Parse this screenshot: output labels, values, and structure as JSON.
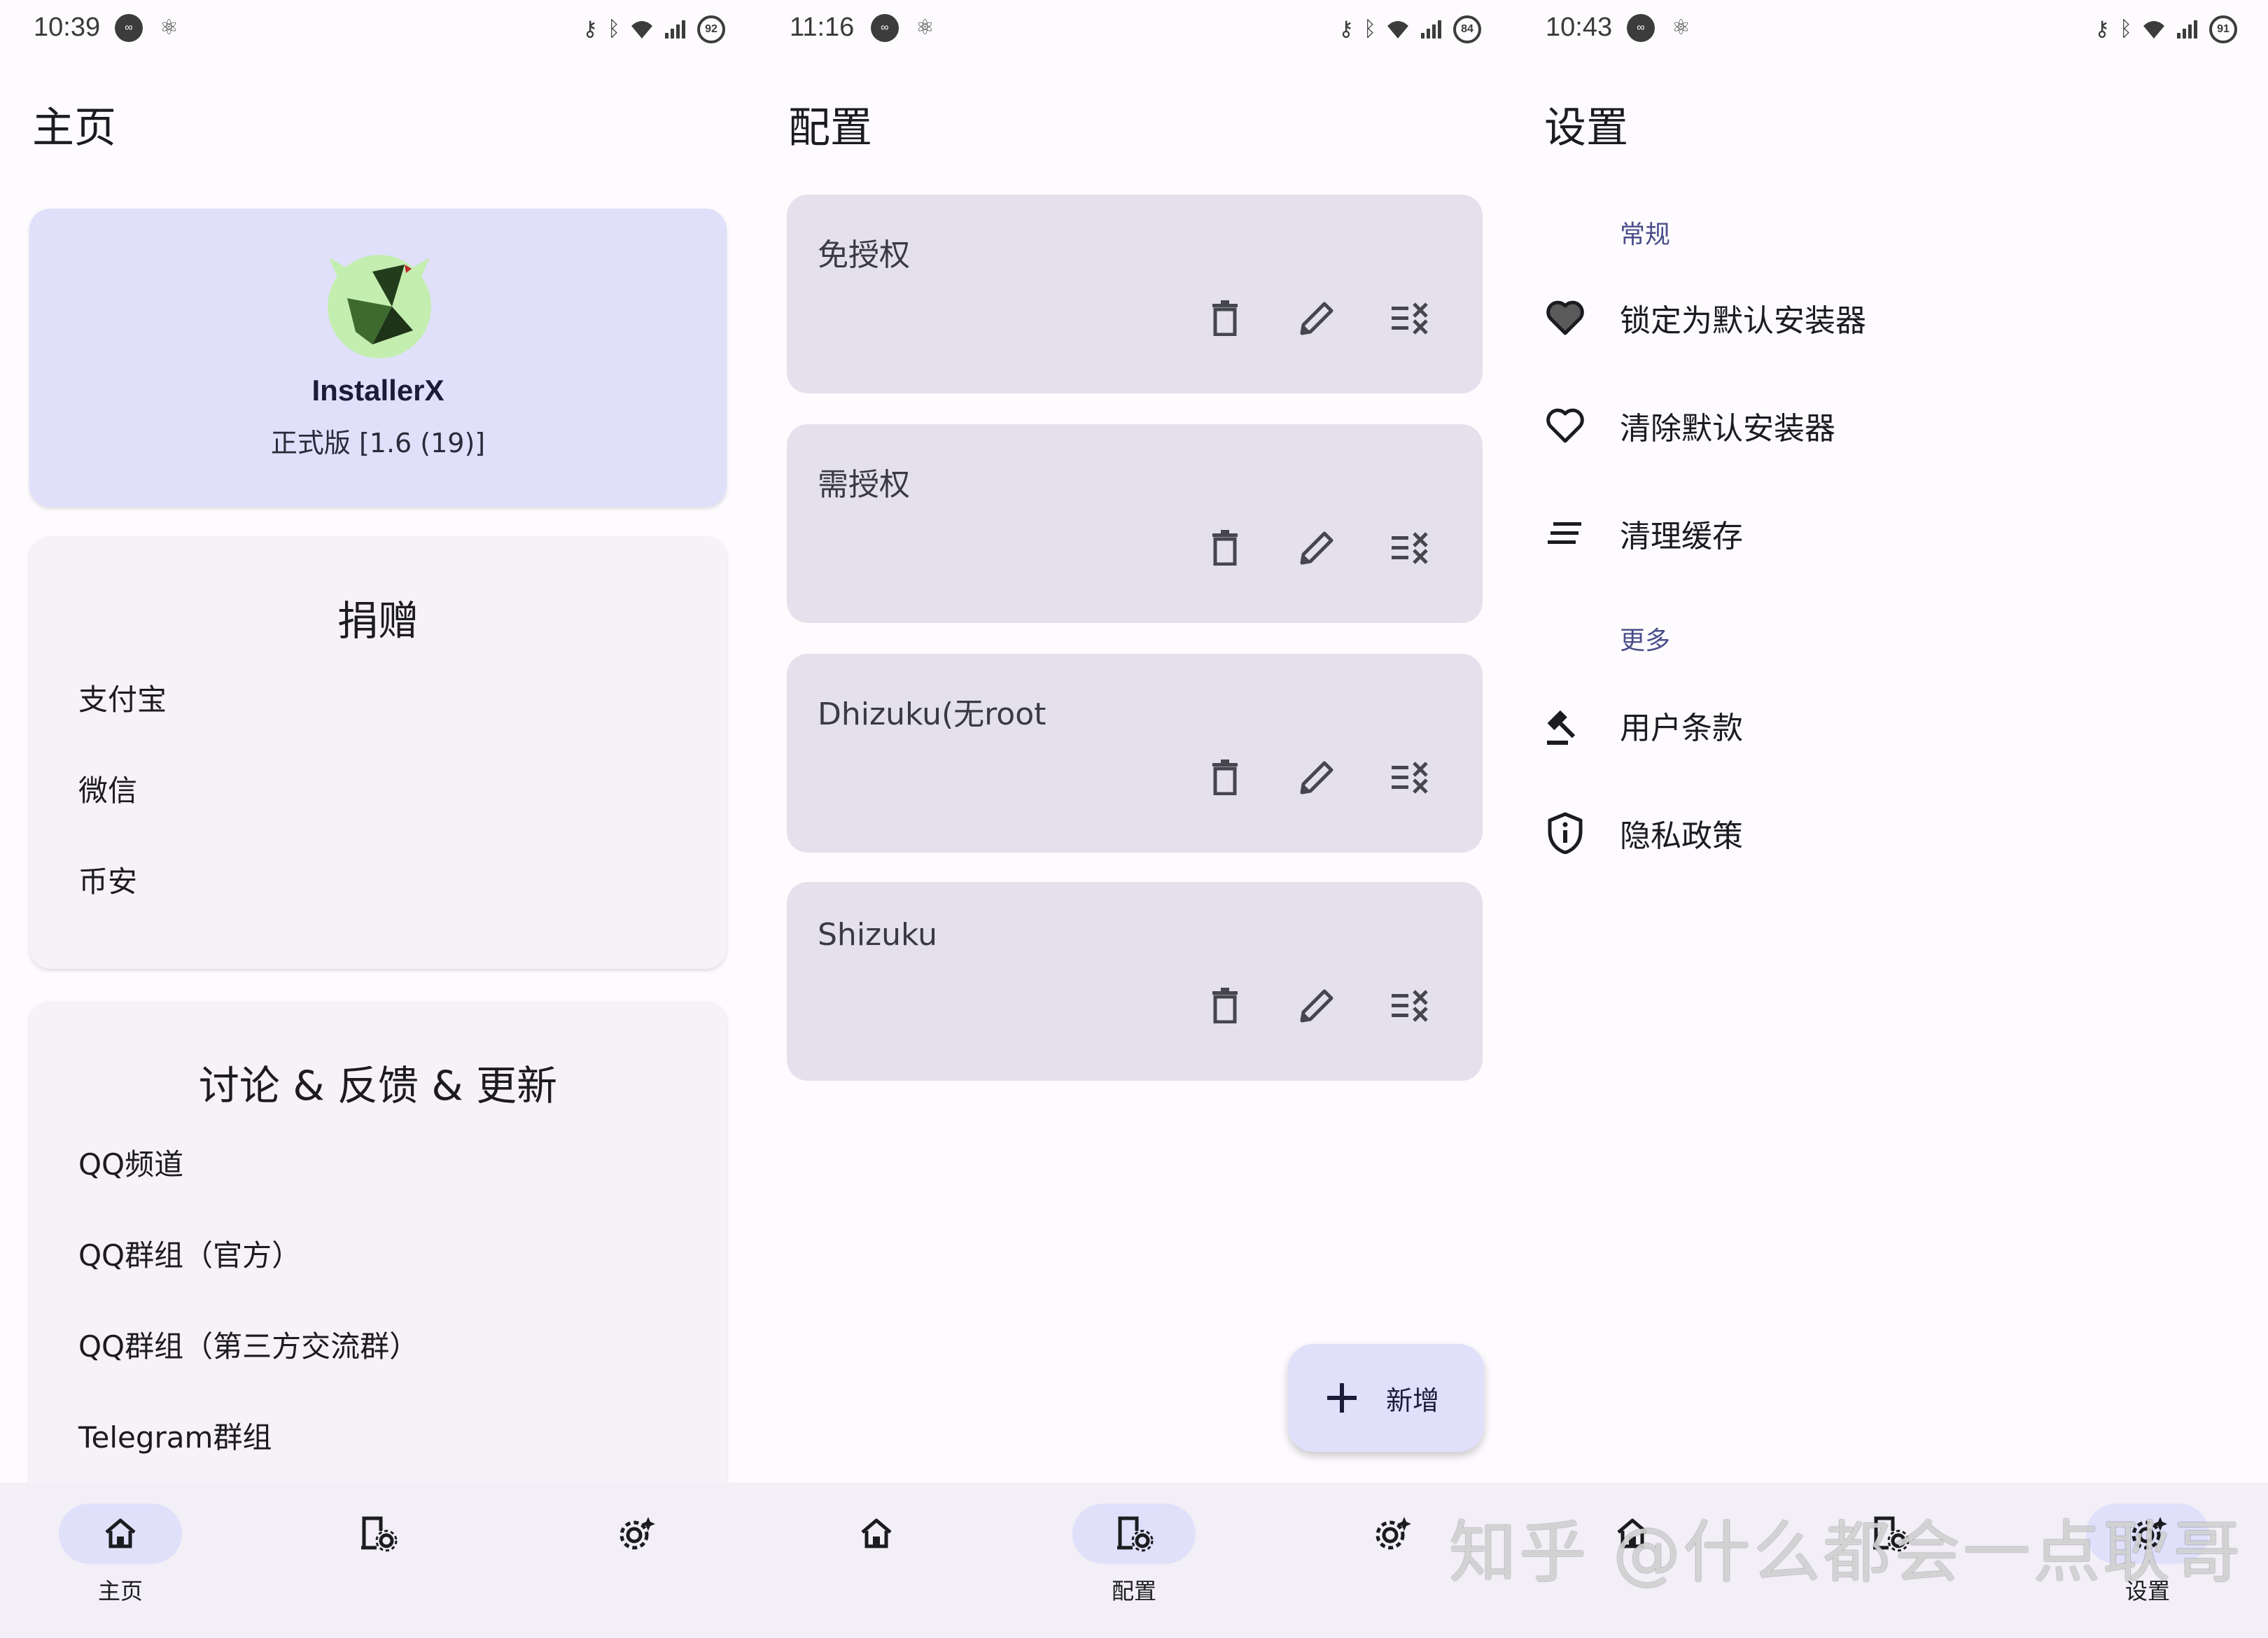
{
  "screens": [
    {
      "status": {
        "time": "10:39",
        "battery": "92"
      },
      "title": "主页",
      "app": {
        "name": "InstallerX",
        "version": "正式版 [1.6 (19)]"
      },
      "donate": {
        "title": "捐赠",
        "items": [
          "支付宝",
          "微信",
          "币安"
        ]
      },
      "discuss": {
        "title": "讨论 & 反馈 & 更新",
        "items": [
          "QQ频道",
          "QQ群组（官方）",
          "QQ群组（第三方交流群）",
          "Telegram群组"
        ]
      }
    },
    {
      "status": {
        "time": "11:16",
        "battery": "84"
      },
      "title": "配置",
      "configs": [
        "免授权",
        "需授权",
        "Dhizuku(无root",
        "Shizuku"
      ],
      "fab_label": "新增"
    },
    {
      "status": {
        "time": "10:43",
        "battery": "91"
      },
      "title": "设置",
      "general_header": "常规",
      "general_items": [
        {
          "label": "锁定为默认安装器",
          "icon": "heart-filled-icon"
        },
        {
          "label": "清除默认安装器",
          "icon": "heart-outline-icon"
        },
        {
          "label": "清理缓存",
          "icon": "clear-all-icon"
        }
      ],
      "more_header": "更多",
      "more_items": [
        {
          "label": "用户条款",
          "icon": "gavel-icon"
        },
        {
          "label": "隐私政策",
          "icon": "shield-info-icon"
        }
      ]
    }
  ],
  "nav": {
    "home": "主页",
    "config": "配置",
    "settings": "设置"
  },
  "watermark": "知乎 @什么都会一点耿哥",
  "colors": {
    "accent_container": "#e0e0fb",
    "card": "#f6f2f8",
    "config_card": "#e4e1ec",
    "nav_bg": "#f2eff6"
  }
}
